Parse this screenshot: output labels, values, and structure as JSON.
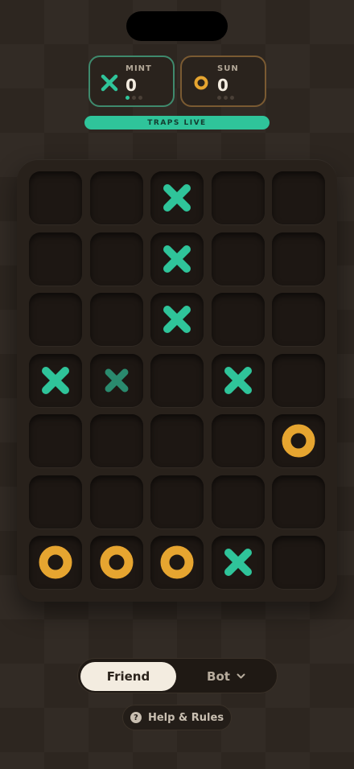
{
  "players": [
    {
      "name": "MINT",
      "score": "0",
      "symbol": "x-icon",
      "color": "#2fc49a",
      "dots": [
        true,
        false,
        false
      ]
    },
    {
      "name": "SUN",
      "score": "0",
      "symbol": "o-icon",
      "color": "#e6a530",
      "dots": [
        false,
        false,
        false
      ]
    }
  ],
  "status_banner": "TRAPS LIVE",
  "board": {
    "rows": 7,
    "cols": 5,
    "cells": [
      [
        "",
        "",
        "X",
        "",
        ""
      ],
      [
        "",
        "",
        "X",
        "",
        ""
      ],
      [
        "",
        "",
        "X",
        "",
        ""
      ],
      [
        "X",
        "x-faded",
        "",
        "X",
        ""
      ],
      [
        "",
        "",
        "",
        "",
        "O"
      ],
      [
        "",
        "",
        "",
        "",
        ""
      ],
      [
        "O",
        "O",
        "O",
        "X",
        ""
      ]
    ]
  },
  "mode": {
    "friend_label": "Friend",
    "bot_label": "Bot",
    "selected": "Friend"
  },
  "help": {
    "label": "Help & Rules",
    "icon_text": "?"
  }
}
